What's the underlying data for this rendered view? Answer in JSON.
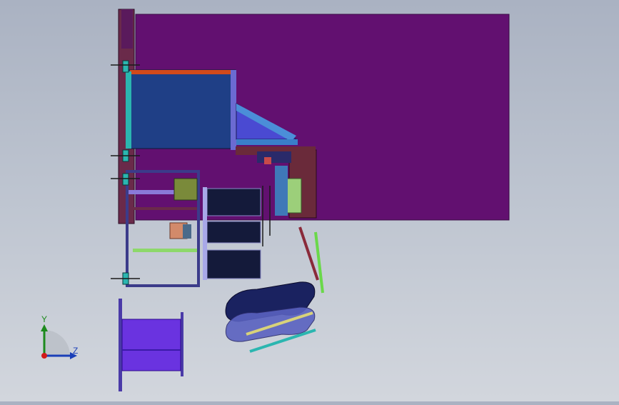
{
  "window": {
    "title": ""
  },
  "triad": {
    "y_label": "Y",
    "z_label": "Z"
  },
  "colors": {
    "background_top": "#aab2c2",
    "background_bottom": "#d2d6dd",
    "main_plate": "#621070",
    "hopper": "#1f3f86",
    "frame": "#3b3b8a",
    "wheel": "#6a33e0",
    "belt": "#1a2260",
    "accent_orange": "#d24a1b",
    "accent_teal": "#2bb6b0",
    "accent_green": "#8dd86a"
  }
}
